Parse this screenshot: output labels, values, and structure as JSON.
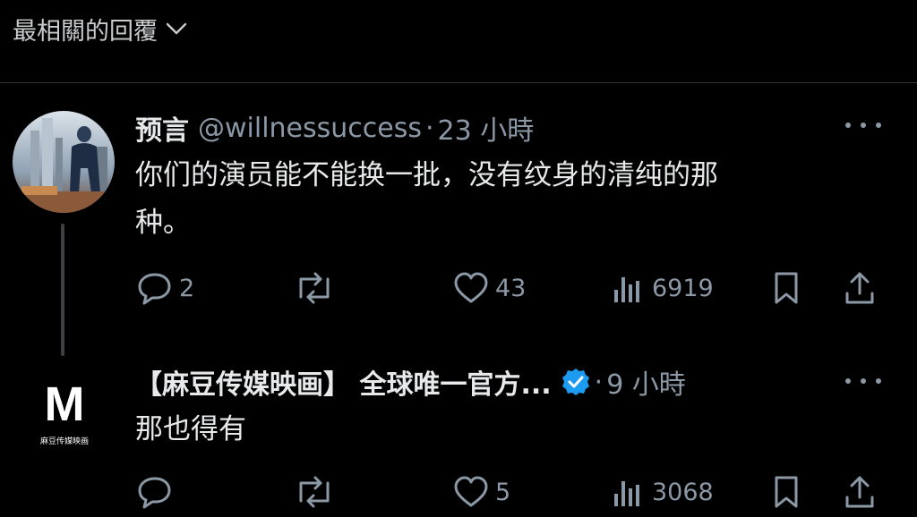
{
  "header": {
    "sort_label": "最相關的回覆"
  },
  "tweets": [
    {
      "name": "预言",
      "handle": "@willnessuccess",
      "separator": "·",
      "time": "23 小時",
      "text_line1": "你们的演员能不能换一批，没有纹身的清纯的那",
      "text_line2": "种。",
      "replies": "2",
      "retweets": "",
      "likes": "43",
      "views": "6919"
    },
    {
      "name": "【麻豆传媒映画】 全球唯一官方...",
      "verified": true,
      "separator": "·",
      "time": "9 小時",
      "text_line1": "那也得有",
      "replies": "",
      "retweets": "",
      "likes": "5",
      "views": "3068",
      "avatar_letter": "M",
      "avatar_caption": "麻豆传媒映画"
    }
  ],
  "icons": {
    "sort": "chevron-down-icon",
    "more": "more-icon",
    "reply": "reply-icon",
    "retweet": "retweet-icon",
    "like": "like-icon",
    "views": "views-icon",
    "bookmark": "bookmark-icon",
    "share": "share-icon",
    "verified": "verified-badge-icon"
  },
  "colors": {
    "background": "#000000",
    "text": "#e7e9ea",
    "muted": "#8b98a5",
    "verified": "#1d9bf0"
  }
}
